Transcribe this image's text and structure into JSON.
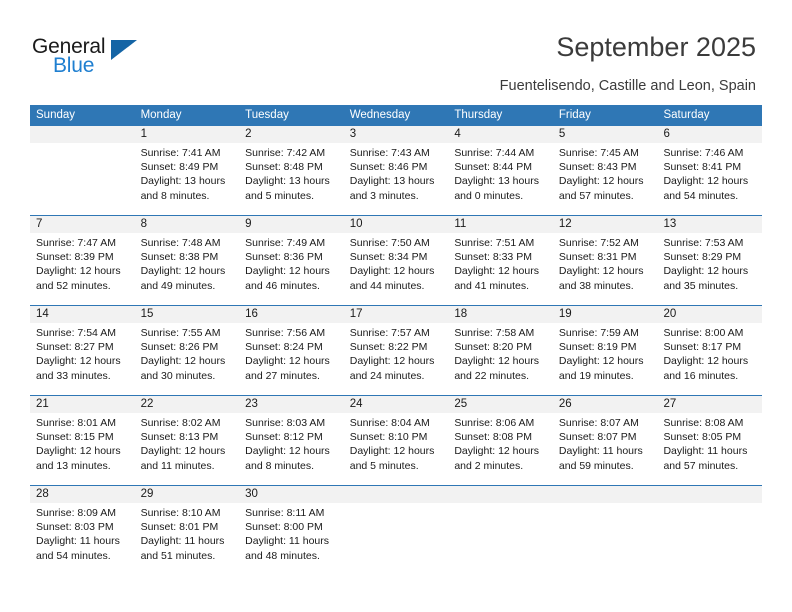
{
  "brand": {
    "name_part1": "General",
    "name_part2": "Blue",
    "logo_icon": "triangle-flag-icon",
    "accent_color": "#1f7fd0",
    "triangle_color": "#1464a5"
  },
  "header": {
    "title": "September 2025",
    "location": "Fuentelisendo, Castille and Leon, Spain"
  },
  "theme": {
    "header_bar_color": "#2f77b5",
    "day_number_band_color": "#f2f2f2",
    "text_color": "#1a1a1a"
  },
  "calendar": {
    "weekday_headers": [
      "Sunday",
      "Monday",
      "Tuesday",
      "Wednesday",
      "Thursday",
      "Friday",
      "Saturday"
    ],
    "weeks": [
      [
        {
          "day": "",
          "empty": true,
          "sunrise": "",
          "sunset": "",
          "daylight_line1": "",
          "daylight_line2": ""
        },
        {
          "day": "1",
          "empty": false,
          "sunrise": "Sunrise: 7:41 AM",
          "sunset": "Sunset: 8:49 PM",
          "daylight_line1": "Daylight: 13 hours",
          "daylight_line2": "and 8 minutes."
        },
        {
          "day": "2",
          "empty": false,
          "sunrise": "Sunrise: 7:42 AM",
          "sunset": "Sunset: 8:48 PM",
          "daylight_line1": "Daylight: 13 hours",
          "daylight_line2": "and 5 minutes."
        },
        {
          "day": "3",
          "empty": false,
          "sunrise": "Sunrise: 7:43 AM",
          "sunset": "Sunset: 8:46 PM",
          "daylight_line1": "Daylight: 13 hours",
          "daylight_line2": "and 3 minutes."
        },
        {
          "day": "4",
          "empty": false,
          "sunrise": "Sunrise: 7:44 AM",
          "sunset": "Sunset: 8:44 PM",
          "daylight_line1": "Daylight: 13 hours",
          "daylight_line2": "and 0 minutes."
        },
        {
          "day": "5",
          "empty": false,
          "sunrise": "Sunrise: 7:45 AM",
          "sunset": "Sunset: 8:43 PM",
          "daylight_line1": "Daylight: 12 hours",
          "daylight_line2": "and 57 minutes."
        },
        {
          "day": "6",
          "empty": false,
          "sunrise": "Sunrise: 7:46 AM",
          "sunset": "Sunset: 8:41 PM",
          "daylight_line1": "Daylight: 12 hours",
          "daylight_line2": "and 54 minutes."
        }
      ],
      [
        {
          "day": "7",
          "empty": false,
          "sunrise": "Sunrise: 7:47 AM",
          "sunset": "Sunset: 8:39 PM",
          "daylight_line1": "Daylight: 12 hours",
          "daylight_line2": "and 52 minutes."
        },
        {
          "day": "8",
          "empty": false,
          "sunrise": "Sunrise: 7:48 AM",
          "sunset": "Sunset: 8:38 PM",
          "daylight_line1": "Daylight: 12 hours",
          "daylight_line2": "and 49 minutes."
        },
        {
          "day": "9",
          "empty": false,
          "sunrise": "Sunrise: 7:49 AM",
          "sunset": "Sunset: 8:36 PM",
          "daylight_line1": "Daylight: 12 hours",
          "daylight_line2": "and 46 minutes."
        },
        {
          "day": "10",
          "empty": false,
          "sunrise": "Sunrise: 7:50 AM",
          "sunset": "Sunset: 8:34 PM",
          "daylight_line1": "Daylight: 12 hours",
          "daylight_line2": "and 44 minutes."
        },
        {
          "day": "11",
          "empty": false,
          "sunrise": "Sunrise: 7:51 AM",
          "sunset": "Sunset: 8:33 PM",
          "daylight_line1": "Daylight: 12 hours",
          "daylight_line2": "and 41 minutes."
        },
        {
          "day": "12",
          "empty": false,
          "sunrise": "Sunrise: 7:52 AM",
          "sunset": "Sunset: 8:31 PM",
          "daylight_line1": "Daylight: 12 hours",
          "daylight_line2": "and 38 minutes."
        },
        {
          "day": "13",
          "empty": false,
          "sunrise": "Sunrise: 7:53 AM",
          "sunset": "Sunset: 8:29 PM",
          "daylight_line1": "Daylight: 12 hours",
          "daylight_line2": "and 35 minutes."
        }
      ],
      [
        {
          "day": "14",
          "empty": false,
          "sunrise": "Sunrise: 7:54 AM",
          "sunset": "Sunset: 8:27 PM",
          "daylight_line1": "Daylight: 12 hours",
          "daylight_line2": "and 33 minutes."
        },
        {
          "day": "15",
          "empty": false,
          "sunrise": "Sunrise: 7:55 AM",
          "sunset": "Sunset: 8:26 PM",
          "daylight_line1": "Daylight: 12 hours",
          "daylight_line2": "and 30 minutes."
        },
        {
          "day": "16",
          "empty": false,
          "sunrise": "Sunrise: 7:56 AM",
          "sunset": "Sunset: 8:24 PM",
          "daylight_line1": "Daylight: 12 hours",
          "daylight_line2": "and 27 minutes."
        },
        {
          "day": "17",
          "empty": false,
          "sunrise": "Sunrise: 7:57 AM",
          "sunset": "Sunset: 8:22 PM",
          "daylight_line1": "Daylight: 12 hours",
          "daylight_line2": "and 24 minutes."
        },
        {
          "day": "18",
          "empty": false,
          "sunrise": "Sunrise: 7:58 AM",
          "sunset": "Sunset: 8:20 PM",
          "daylight_line1": "Daylight: 12 hours",
          "daylight_line2": "and 22 minutes."
        },
        {
          "day": "19",
          "empty": false,
          "sunrise": "Sunrise: 7:59 AM",
          "sunset": "Sunset: 8:19 PM",
          "daylight_line1": "Daylight: 12 hours",
          "daylight_line2": "and 19 minutes."
        },
        {
          "day": "20",
          "empty": false,
          "sunrise": "Sunrise: 8:00 AM",
          "sunset": "Sunset: 8:17 PM",
          "daylight_line1": "Daylight: 12 hours",
          "daylight_line2": "and 16 minutes."
        }
      ],
      [
        {
          "day": "21",
          "empty": false,
          "sunrise": "Sunrise: 8:01 AM",
          "sunset": "Sunset: 8:15 PM",
          "daylight_line1": "Daylight: 12 hours",
          "daylight_line2": "and 13 minutes."
        },
        {
          "day": "22",
          "empty": false,
          "sunrise": "Sunrise: 8:02 AM",
          "sunset": "Sunset: 8:13 PM",
          "daylight_line1": "Daylight: 12 hours",
          "daylight_line2": "and 11 minutes."
        },
        {
          "day": "23",
          "empty": false,
          "sunrise": "Sunrise: 8:03 AM",
          "sunset": "Sunset: 8:12 PM",
          "daylight_line1": "Daylight: 12 hours",
          "daylight_line2": "and 8 minutes."
        },
        {
          "day": "24",
          "empty": false,
          "sunrise": "Sunrise: 8:04 AM",
          "sunset": "Sunset: 8:10 PM",
          "daylight_line1": "Daylight: 12 hours",
          "daylight_line2": "and 5 minutes."
        },
        {
          "day": "25",
          "empty": false,
          "sunrise": "Sunrise: 8:06 AM",
          "sunset": "Sunset: 8:08 PM",
          "daylight_line1": "Daylight: 12 hours",
          "daylight_line2": "and 2 minutes."
        },
        {
          "day": "26",
          "empty": false,
          "sunrise": "Sunrise: 8:07 AM",
          "sunset": "Sunset: 8:07 PM",
          "daylight_line1": "Daylight: 11 hours",
          "daylight_line2": "and 59 minutes."
        },
        {
          "day": "27",
          "empty": false,
          "sunrise": "Sunrise: 8:08 AM",
          "sunset": "Sunset: 8:05 PM",
          "daylight_line1": "Daylight: 11 hours",
          "daylight_line2": "and 57 minutes."
        }
      ],
      [
        {
          "day": "28",
          "empty": false,
          "sunrise": "Sunrise: 8:09 AM",
          "sunset": "Sunset: 8:03 PM",
          "daylight_line1": "Daylight: 11 hours",
          "daylight_line2": "and 54 minutes."
        },
        {
          "day": "29",
          "empty": false,
          "sunrise": "Sunrise: 8:10 AM",
          "sunset": "Sunset: 8:01 PM",
          "daylight_line1": "Daylight: 11 hours",
          "daylight_line2": "and 51 minutes."
        },
        {
          "day": "30",
          "empty": false,
          "sunrise": "Sunrise: 8:11 AM",
          "sunset": "Sunset: 8:00 PM",
          "daylight_line1": "Daylight: 11 hours",
          "daylight_line2": "and 48 minutes."
        },
        {
          "day": "",
          "empty": true,
          "sunrise": "",
          "sunset": "",
          "daylight_line1": "",
          "daylight_line2": ""
        },
        {
          "day": "",
          "empty": true,
          "sunrise": "",
          "sunset": "",
          "daylight_line1": "",
          "daylight_line2": ""
        },
        {
          "day": "",
          "empty": true,
          "sunrise": "",
          "sunset": "",
          "daylight_line1": "",
          "daylight_line2": ""
        },
        {
          "day": "",
          "empty": true,
          "sunrise": "",
          "sunset": "",
          "daylight_line1": "",
          "daylight_line2": ""
        }
      ]
    ]
  }
}
